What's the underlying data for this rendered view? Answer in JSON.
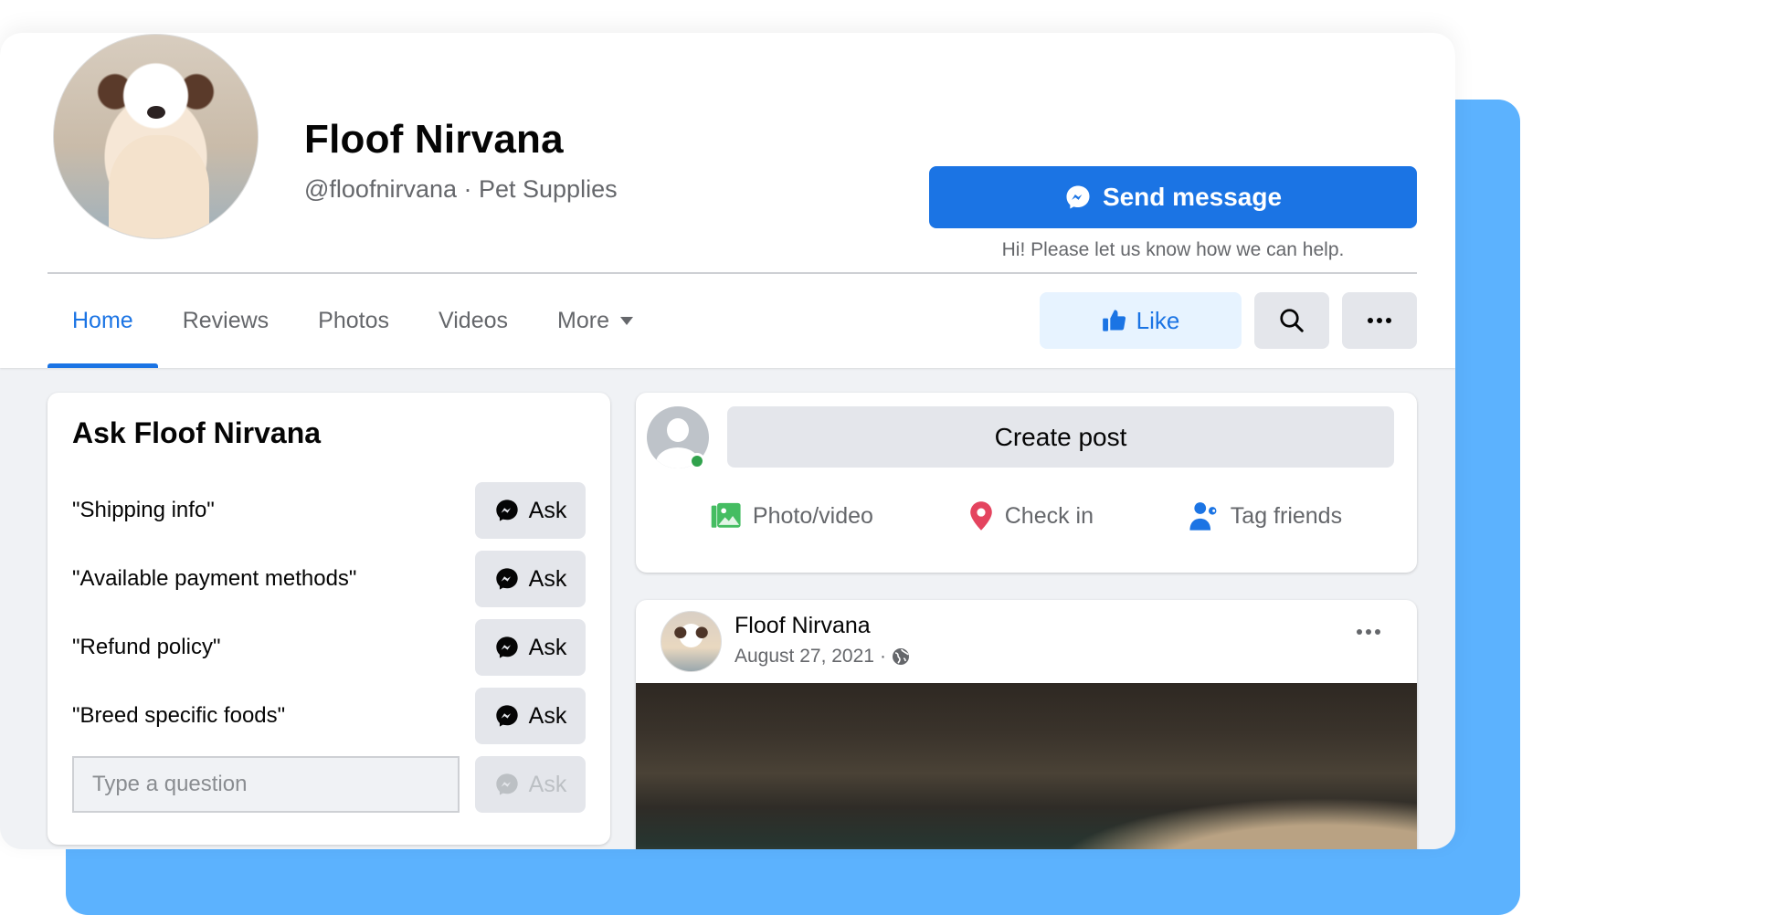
{
  "colors": {
    "accent": "#1b74e4",
    "backdrop": "#5cb2fe",
    "online": "#31a24c",
    "photo_icon": "#45bd62",
    "checkin_icon": "#e4445f"
  },
  "header": {
    "page_name": "Floof Nirvana",
    "handle_and_category": "@floofnirvana · Pet Supplies",
    "send_message_label": "Send message",
    "send_message_helper": "Hi! Please let us know how we can help.",
    "tabs": [
      {
        "label": "Home",
        "active": true
      },
      {
        "label": "Reviews",
        "active": false
      },
      {
        "label": "Photos",
        "active": false
      },
      {
        "label": "Videos",
        "active": false
      },
      {
        "label": "More",
        "active": false
      }
    ],
    "like_label": "Like"
  },
  "ask_panel": {
    "title": "Ask Floof Nirvana",
    "questions": [
      {
        "text": "\"Shipping info\"",
        "button": "Ask"
      },
      {
        "text": "\"Available payment methods\"",
        "button": "Ask"
      },
      {
        "text": "\"Refund policy\"",
        "button": "Ask"
      },
      {
        "text": "\"Breed specific foods\"",
        "button": "Ask"
      }
    ],
    "input_placeholder": "Type a question",
    "input_value": "",
    "input_button": "Ask"
  },
  "composer": {
    "create_post_label": "Create post",
    "actions": [
      {
        "label": "Photo/video",
        "icon": "photo-video-icon"
      },
      {
        "label": "Check in",
        "icon": "location-pin-icon"
      },
      {
        "label": "Tag friends",
        "icon": "tag-friends-icon"
      }
    ]
  },
  "post": {
    "author": "Floof Nirvana",
    "date": "August 27, 2021",
    "separator": "·",
    "audience_icon": "globe-icon"
  }
}
